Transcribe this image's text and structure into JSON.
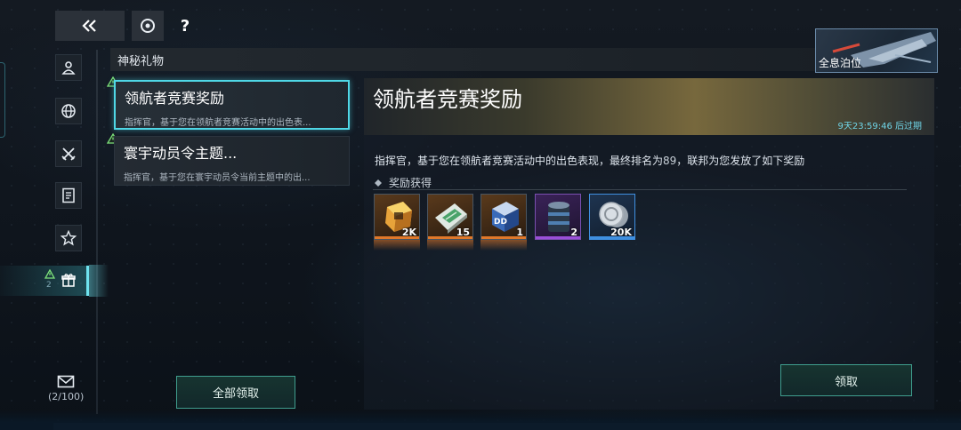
{
  "toolbar": {
    "back_icon": "double-chevron-left-icon",
    "settings_icon": "settings-ring-icon",
    "help_label": "?"
  },
  "category": {
    "title": "神秘礼物"
  },
  "hologram_badge": {
    "label": "全息泊位"
  },
  "left_nav": {
    "items": [
      {
        "icon": "person-icon"
      },
      {
        "icon": "globe-icon"
      },
      {
        "icon": "crossed-swords-icon"
      },
      {
        "icon": "document-icon"
      },
      {
        "icon": "star-icon"
      },
      {
        "icon": "gift-icon",
        "active": true,
        "count": "2"
      }
    ],
    "mail_icon": "envelope-icon",
    "mail_count": "(2/100)"
  },
  "mail_list": [
    {
      "title": "领航者竞赛奖励",
      "preview": "指挥官，基于您在领航者竞赛活动中的出色表...",
      "selected": true
    },
    {
      "title": "寰宇动员令主题...",
      "preview": "指挥官，基于您在寰宇动员令当前主题中的出...",
      "selected": false
    }
  ],
  "claim_all_label": "全部领取",
  "detail": {
    "title": "领航者竞赛奖励",
    "expire_text": "9天23:59:46 后过期",
    "body_prefix": "指挥官，基于您在领航者竞赛活动中的出色表现，最终排名为",
    "body_rank": "89",
    "body_suffix": "，联邦为您发放了如下奖励",
    "rewards_label": "奖励获得",
    "rewards": [
      {
        "icon": "gold-crate-icon",
        "quantity": "2K",
        "rarity_color": "#e0782a"
      },
      {
        "icon": "chip-board-icon",
        "quantity": "15",
        "rarity_color": "#e0782a"
      },
      {
        "icon": "dd-cube-icon",
        "quantity": "1",
        "rarity_color": "#e0782a"
      },
      {
        "icon": "canister-icon",
        "quantity": "2",
        "rarity_color": "#9a4fd8"
      },
      {
        "icon": "silver-coin-icon",
        "quantity": "20K",
        "rarity_color": "#3f8fe0"
      }
    ],
    "claim_label": "领取"
  }
}
